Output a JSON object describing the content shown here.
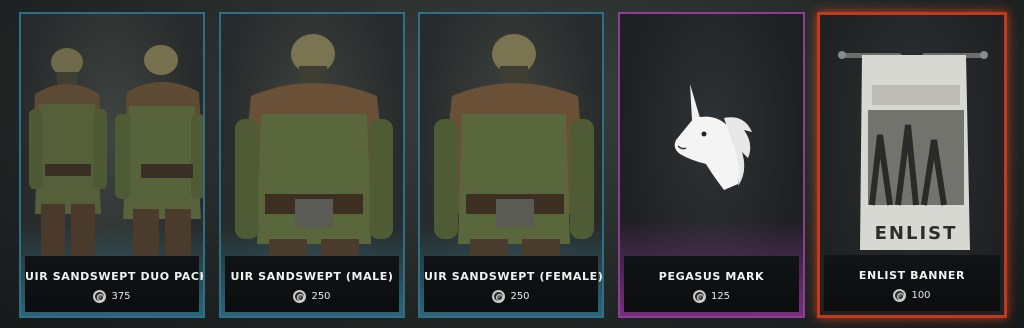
{
  "store": {
    "items": [
      {
        "name": "UIR SANDSWEPT DUO PACK",
        "price": "375"
      },
      {
        "name": "UIR SANDSWEPT (MALE)",
        "price": "250"
      },
      {
        "name": "UIR SANDSWEPT (FEMALE)",
        "price": "250"
      },
      {
        "name": "PEGASUS MARK",
        "price": "125"
      },
      {
        "name": "ENLIST BANNER",
        "price": "100"
      }
    ],
    "banner_text": "ENLIST"
  },
  "colors": {
    "rarity_common": "#2e6f86",
    "rarity_epic": "#8c3f92",
    "rarity_legendary": "#c2391e"
  },
  "icons": {
    "currency": "iron-coin-icon"
  }
}
